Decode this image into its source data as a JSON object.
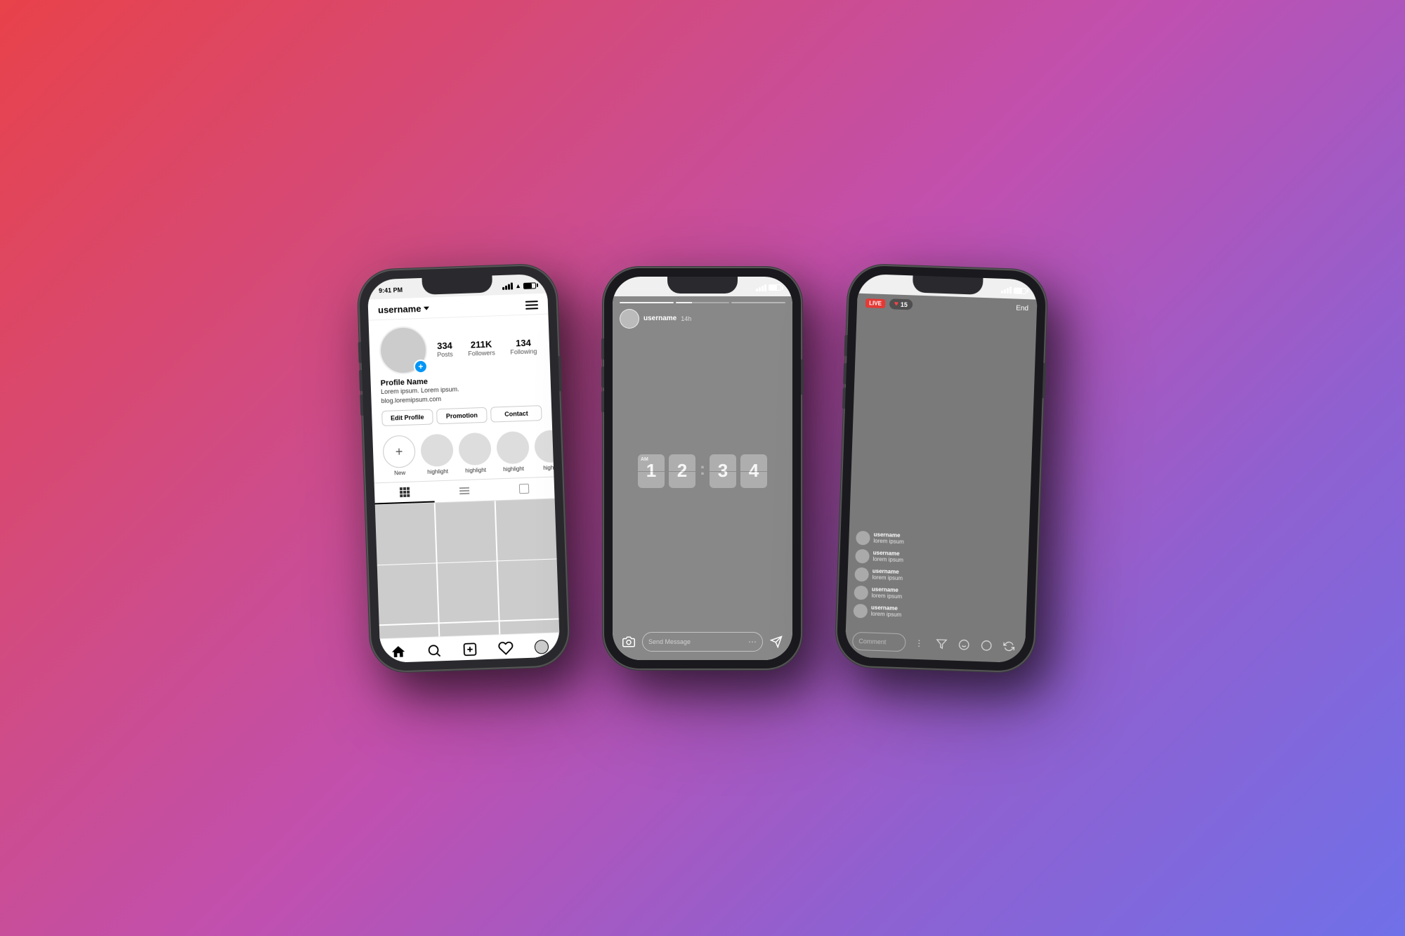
{
  "background": {
    "gradient": "linear-gradient(135deg, #e8424a 0%, #d44a7a 25%, #c050b0 50%, #9060d0 75%, #7070e8 100%)"
  },
  "phone1": {
    "status_bar": {
      "time": "9:41 PM"
    },
    "nav": {
      "username": "username",
      "menu_label": "menu"
    },
    "stats": {
      "posts_count": "334",
      "posts_label": "Posts",
      "followers_count": "211K",
      "followers_label": "Followers",
      "following_count": "134",
      "following_label": "Following"
    },
    "profile": {
      "name": "Profile Name",
      "bio_line1": "Lorem ipsum. Lorem ipsum.",
      "bio_line2": "blog.loremipsum.com"
    },
    "buttons": {
      "edit": "Edit Profile",
      "promotion": "Promotion",
      "contact": "Contact"
    },
    "highlights": [
      {
        "label": "New"
      },
      {
        "label": "highlight"
      },
      {
        "label": "highlight"
      },
      {
        "label": "highlight"
      },
      {
        "label": "highl..."
      }
    ]
  },
  "phone2": {
    "status_bar": {
      "time": ""
    },
    "story": {
      "username": "username",
      "time": "14h",
      "clock": {
        "hours": "12",
        "minutes": "34",
        "am_pm": "AM"
      },
      "message_placeholder": "Send Message",
      "message_dots": "⋯"
    }
  },
  "phone3": {
    "status_bar": {
      "time": ""
    },
    "live": {
      "badge": "LIVE",
      "viewers": "15",
      "end_label": "End",
      "comments": [
        {
          "username": "username",
          "text": "lorem ipsum"
        },
        {
          "username": "username",
          "text": "lorem ipsum"
        },
        {
          "username": "username",
          "text": "lorem ipsum"
        },
        {
          "username": "username",
          "text": "lorem ipsum"
        },
        {
          "username": "username",
          "text": "lorem ipsum"
        }
      ],
      "comment_placeholder": "Comment"
    }
  }
}
